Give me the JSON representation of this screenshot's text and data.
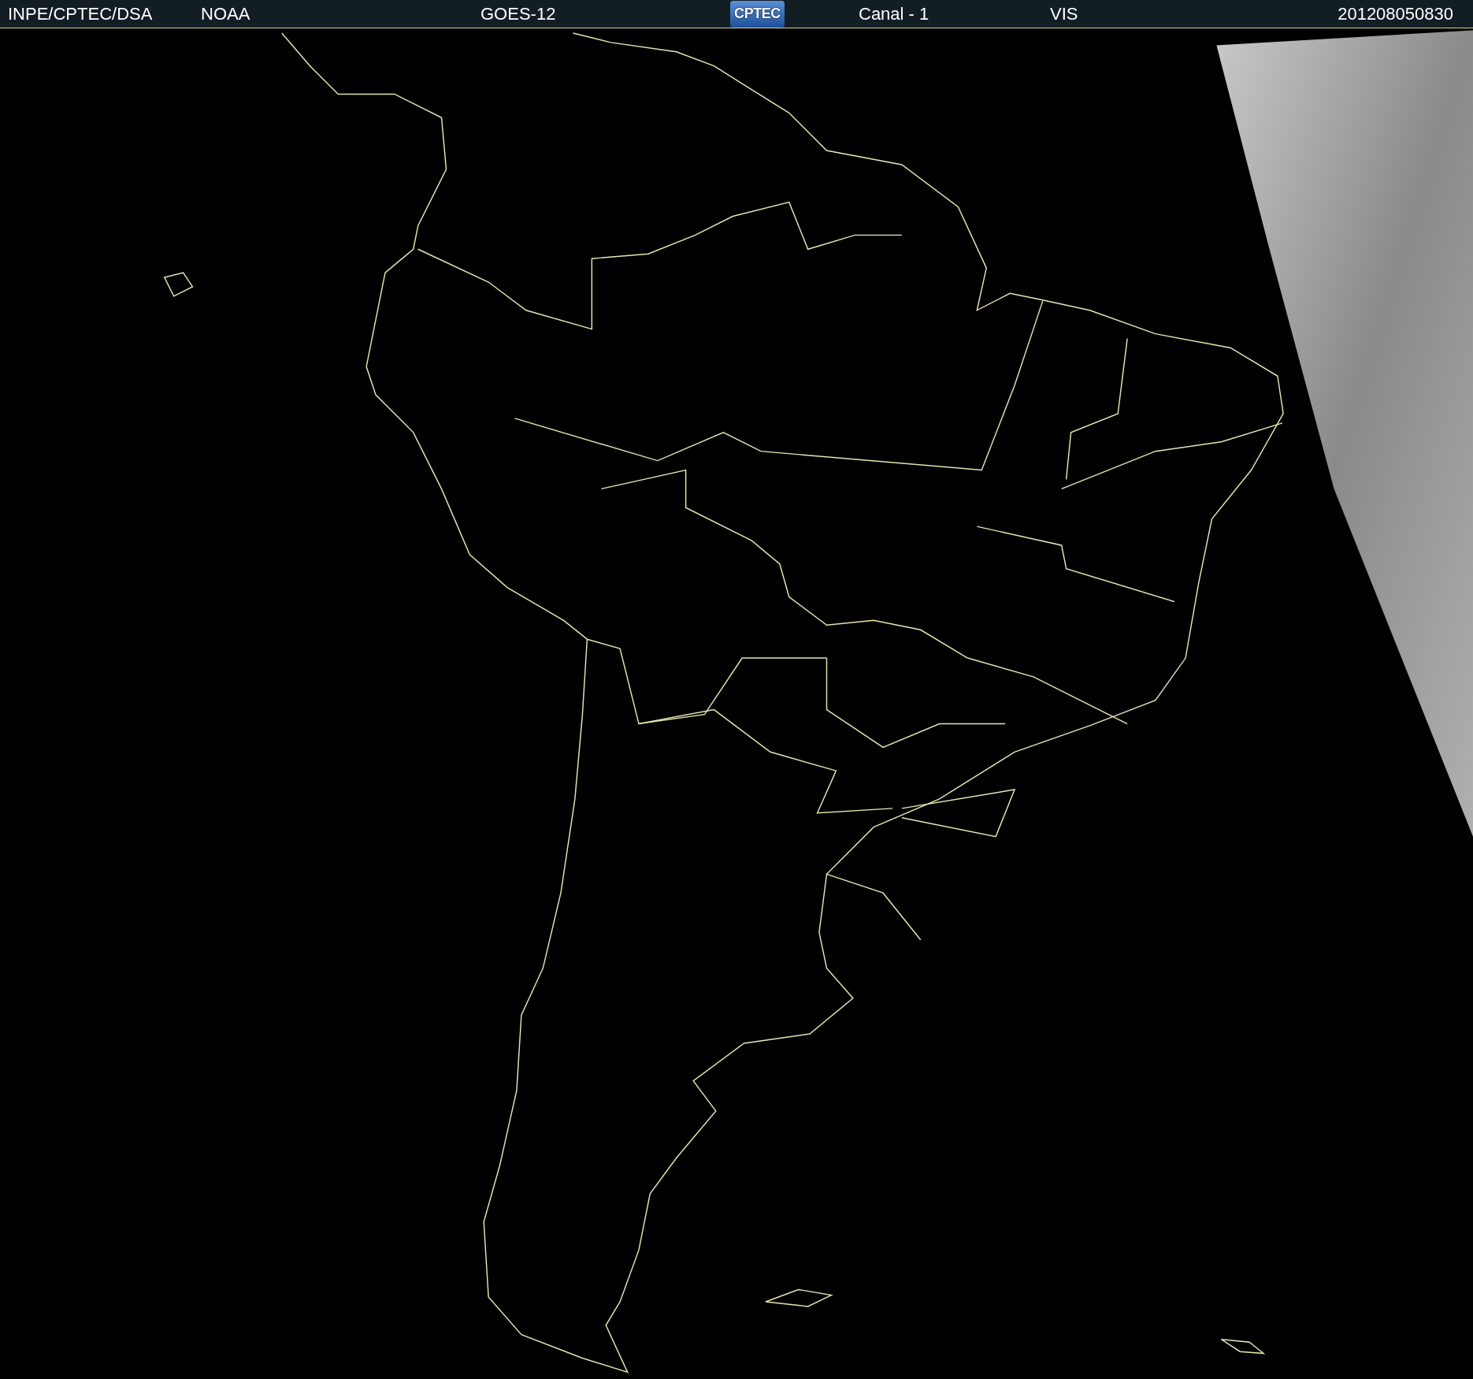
{
  "header": {
    "items": [
      {
        "kind": "text",
        "text": "INPE/CPTEC/DSA"
      },
      {
        "kind": "text",
        "text": "NOAA"
      },
      {
        "kind": "text",
        "text": "GOES-12"
      },
      {
        "kind": "logo",
        "text": "CPTEC"
      },
      {
        "kind": "text",
        "text": "Canal - 1"
      },
      {
        "kind": "text",
        "text": "VIS"
      },
      {
        "kind": "text",
        "text": "201208050830"
      }
    ]
  }
}
